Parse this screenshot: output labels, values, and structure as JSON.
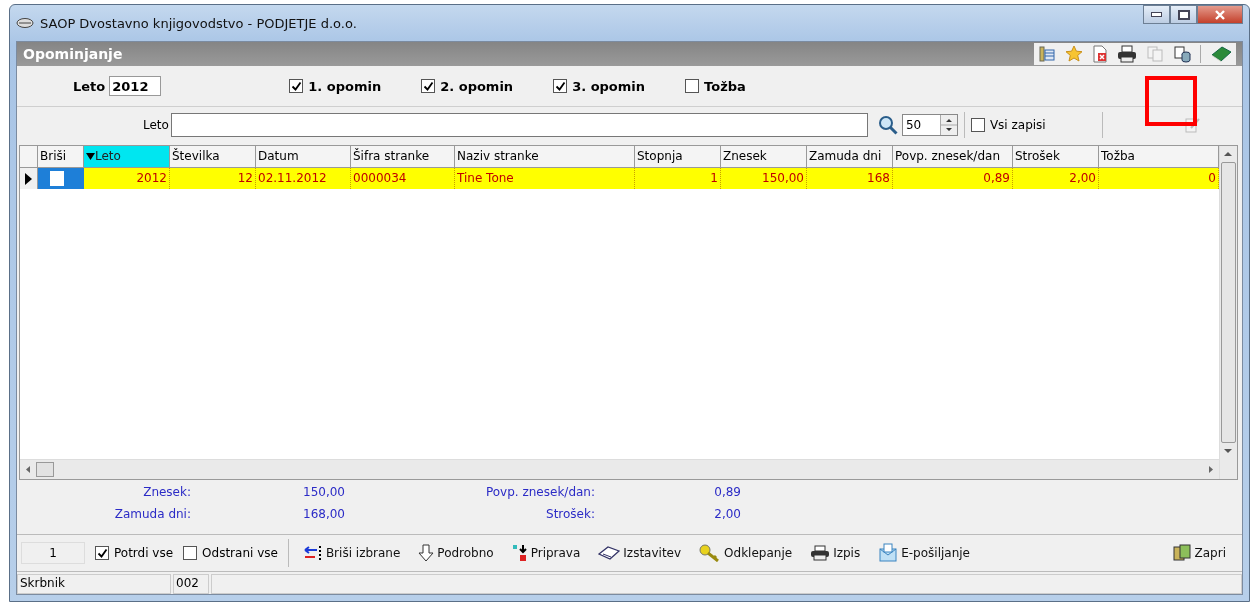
{
  "window": {
    "title": "SAOP Dvostavno knjigovodstvo - PODJETJE d.o.o."
  },
  "panel": {
    "title": "Opominjanje"
  },
  "filters": {
    "year_label": "Leto",
    "year_value": "2012",
    "options": [
      {
        "label": "1. opomin",
        "checked": true
      },
      {
        "label": "2. opomin",
        "checked": true
      },
      {
        "label": "3. opomin",
        "checked": true
      },
      {
        "label": "Tožba",
        "checked": false
      }
    ]
  },
  "search": {
    "label": "Leto",
    "count": "50",
    "all_records": {
      "label": "Vsi zapisi",
      "checked": false
    }
  },
  "highlight": {
    "visible": true
  },
  "table": {
    "columns": [
      {
        "label": "Briši",
        "sorted": false
      },
      {
        "label": "Leto",
        "sorted": true
      },
      {
        "label": "Številka",
        "sorted": false
      },
      {
        "label": "Datum",
        "sorted": false
      },
      {
        "label": "Šifra stranke",
        "sorted": false
      },
      {
        "label": "Naziv stranke",
        "sorted": false
      },
      {
        "label": "Stopnja",
        "sorted": false
      },
      {
        "label": "Znesek",
        "sorted": false
      },
      {
        "label": "Zamuda dni",
        "sorted": false
      },
      {
        "label": "Povp. znesek/dan",
        "sorted": false
      },
      {
        "label": "Strošek",
        "sorted": false
      },
      {
        "label": "Tožba",
        "sorted": false
      }
    ],
    "rows": [
      {
        "selected": true,
        "delete_checked": false,
        "cells": [
          "",
          "2012",
          "12",
          "02.11.2012",
          "0000034",
          "Tine Tone",
          "1",
          "150,00",
          "168",
          "0,89",
          "2,00",
          "0"
        ]
      }
    ]
  },
  "totals": [
    {
      "label": "Znesek:",
      "value": "150,00"
    },
    {
      "label": "Povp. znesek/dan:",
      "value": "0,89"
    },
    {
      "label": "Zamuda dni:",
      "value": "168,00"
    },
    {
      "label": "Strošek:",
      "value": "2,00"
    }
  ],
  "action_bar": {
    "count": "1",
    "confirm_all": {
      "label": "Potrdi vse",
      "checked": true
    },
    "remove_all": {
      "label": "Odstrani vse",
      "checked": false
    },
    "buttons": [
      {
        "kind": "delete",
        "label": "Briši izbrane"
      },
      {
        "kind": "detail",
        "label": "Podrobno"
      },
      {
        "kind": "prepare",
        "label": "Priprava"
      },
      {
        "kind": "issue",
        "label": "Izstavitev"
      },
      {
        "kind": "unlock",
        "label": "Odklepanje"
      },
      {
        "kind": "print",
        "label": "Izpis"
      },
      {
        "kind": "email",
        "label": "E-pošiljanje"
      },
      {
        "kind": "close",
        "label": "Zapri"
      }
    ]
  },
  "status_bar": {
    "user": "Skrbnik",
    "code": "002"
  }
}
